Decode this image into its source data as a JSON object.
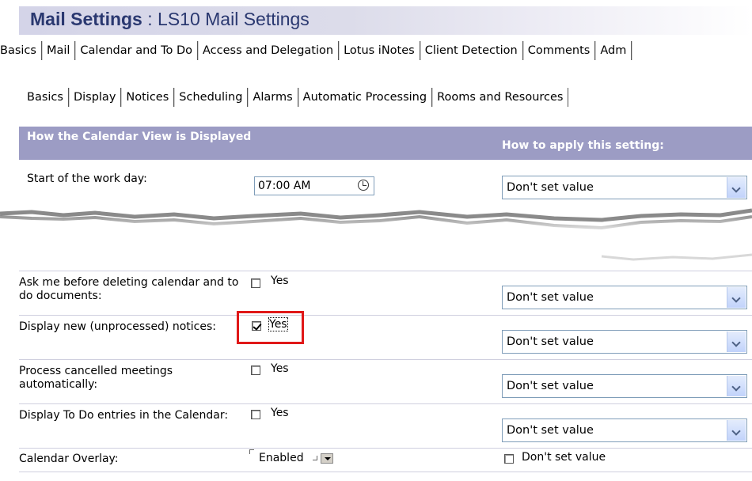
{
  "title": {
    "bold": "Mail Settings",
    "rest": " : LS10 Mail Settings"
  },
  "main_tabs": [
    "Basics",
    "Mail",
    "Calendar and To Do",
    "Access and Delegation",
    "Lotus iNotes",
    "Client Detection",
    "Comments",
    "Adm"
  ],
  "sub_tabs": [
    "Basics",
    "Display",
    "Notices",
    "Scheduling",
    "Alarms",
    "Automatic Processing",
    "Rooms and Resources"
  ],
  "section": {
    "heading": "How the Calendar View is Displayed",
    "apply_heading": "How to apply this setting:"
  },
  "start_of_work_day": {
    "label": "Start of the work day:",
    "value": "07:00 AM",
    "apply_value": "Don't set value"
  },
  "settings": [
    {
      "label": "Ask me before deleting calendar and to do documents:",
      "checked": false,
      "option": "Yes",
      "apply_value": "Don't set value"
    },
    {
      "label": "Display new (unprocessed) notices:",
      "checked": true,
      "option": "Yes",
      "apply_value": "Don't set value"
    },
    {
      "label": "Process cancelled meetings automatically:",
      "checked": false,
      "option": "Yes",
      "apply_value": "Don't set value"
    },
    {
      "label": "Display To Do entries in the Calendar:",
      "checked": false,
      "option": "Yes",
      "apply_value": "Don't set value"
    }
  ],
  "calendar_overlay": {
    "label": "Calendar Overlay:",
    "value": "Enabled",
    "apply_option": "Don't set value",
    "apply_checked": false
  },
  "colors": {
    "title_text": "#2a3870",
    "section_header_bg": "#9c9cc4",
    "highlight_border": "#e01818"
  }
}
